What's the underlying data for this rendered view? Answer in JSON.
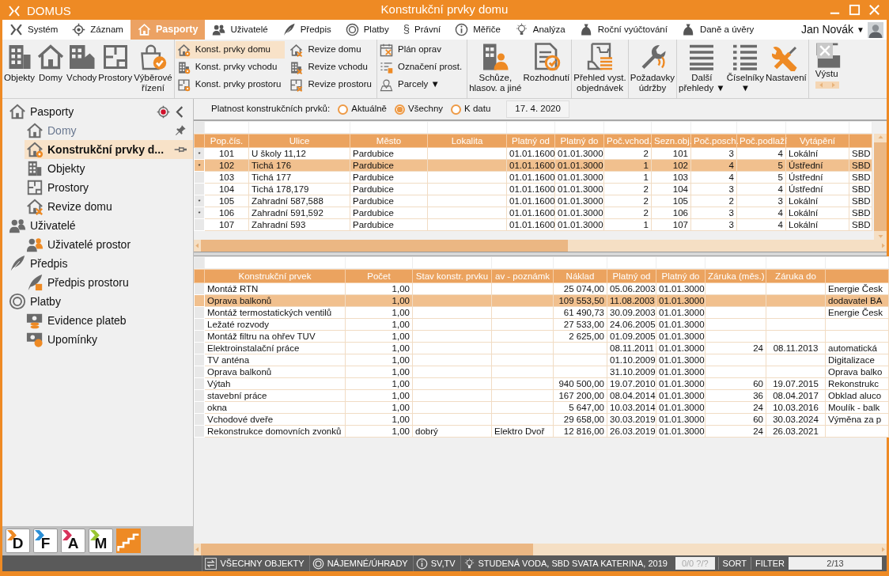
{
  "window": {
    "app": "DOMUS",
    "title": "Konstrukční prvky domu"
  },
  "menu": {
    "tabs": [
      {
        "label": "Systém",
        "selected": false
      },
      {
        "label": "Záznam",
        "selected": false
      },
      {
        "label": "Pasporty",
        "selected": true
      },
      {
        "label": "Uživatelé",
        "selected": false
      },
      {
        "label": "Předpis",
        "selected": false
      },
      {
        "label": "Platby",
        "selected": false
      },
      {
        "label": "Právní",
        "selected": false,
        "symbol": "§"
      },
      {
        "label": "Měřiče",
        "selected": false
      },
      {
        "label": "Analýza",
        "selected": false
      },
      {
        "label": "Roční vyúčtování",
        "selected": false
      },
      {
        "label": "Daně a úvěry",
        "selected": false
      }
    ],
    "user": "Jan Novák",
    "user_caret": "▼"
  },
  "ribbon": {
    "groups": [
      {
        "kind": "large",
        "buttons": [
          {
            "label": "Objekty"
          },
          {
            "label": "Domy"
          },
          {
            "label": "Vchody"
          },
          {
            "label": "Prostory"
          },
          {
            "label": "Výběrové\nřízení"
          }
        ]
      },
      {
        "kind": "small",
        "buttons": [
          {
            "label": "Konst. prvky domu",
            "selected": true
          },
          {
            "label": "Konst. prvky vchodu",
            "selected": false
          },
          {
            "label": "Konst. prvky prostoru",
            "selected": false
          },
          {
            "label": "Revize domu",
            "selected": false
          },
          {
            "label": "Revize vchodu",
            "selected": false
          },
          {
            "label": "Revize prostoru",
            "selected": false
          }
        ]
      },
      {
        "kind": "small",
        "buttons": [
          {
            "label": "Plán oprav",
            "selected": false
          },
          {
            "label": "Označení prost.",
            "selected": false
          },
          {
            "label": "Parcely ▼",
            "selected": false
          }
        ]
      },
      {
        "kind": "large",
        "buttons": [
          {
            "label": "Schůze,\nhlasov. a jiné"
          },
          {
            "label": "Rozhodnutí"
          }
        ]
      },
      {
        "kind": "large",
        "buttons": [
          {
            "label": "Přehled vyst.\nobjednávek"
          }
        ]
      },
      {
        "kind": "large",
        "buttons": [
          {
            "label": "Požadavky\núdržby"
          }
        ]
      },
      {
        "kind": "large",
        "buttons": [
          {
            "label": "Další\npřehledy ▼"
          },
          {
            "label": "Číselníky\n▼"
          },
          {
            "label": "Nastavení"
          }
        ]
      },
      {
        "kind": "cut",
        "buttons": [
          {
            "label": "Výstu"
          }
        ]
      }
    ]
  },
  "sidebar": {
    "items": [
      {
        "label": "Pasporty",
        "children": [
          {
            "label": "Domy",
            "selected": false,
            "dimmed": true,
            "pinned": false
          },
          {
            "label": "Konstrukční prvky d...",
            "selected": true,
            "dimmed": false,
            "pinned": true
          },
          {
            "label": "Objekty",
            "selected": false,
            "dimmed": false
          },
          {
            "label": "Prostory",
            "selected": false,
            "dimmed": false
          },
          {
            "label": "Revize domu",
            "selected": false,
            "dimmed": false
          }
        ]
      },
      {
        "label": "Uživatelé",
        "children": [
          {
            "label": "Uživatelé prostor",
            "selected": false,
            "dimmed": false
          }
        ]
      },
      {
        "label": "Předpis",
        "children": [
          {
            "label": "Předpis prostoru",
            "selected": false,
            "dimmed": false
          }
        ]
      },
      {
        "label": "Platby",
        "children": [
          {
            "label": "Evidence plateb",
            "selected": false,
            "dimmed": false
          },
          {
            "label": "Upomínky",
            "selected": false,
            "dimmed": false
          }
        ]
      }
    ]
  },
  "apps": [
    {
      "kind": "letter",
      "letter": "D",
      "color": "#ee8a24"
    },
    {
      "kind": "letter",
      "letter": "F",
      "color": "#2b8fd6"
    },
    {
      "kind": "letter",
      "letter": "A",
      "color": "#d8325a"
    },
    {
      "kind": "letter",
      "letter": "M",
      "color": "#9ac531"
    },
    {
      "kind": "stairs",
      "color": "#ee8a24"
    }
  ],
  "filter": {
    "label": "Platnost konstrukčních prvků:",
    "options": [
      {
        "label": "Aktuálně",
        "selected": false
      },
      {
        "label": "Všechny",
        "selected": true
      },
      {
        "label": "K datu",
        "selected": false
      }
    ],
    "date": "17. 4. 2020"
  },
  "upper_table": {
    "columns": [
      "Pop.čís.",
      "Ulice",
      "Město",
      "Lokalita",
      "Platný od",
      "Platný do",
      "Poč.vchod.",
      "Sezn.obj.",
      "Poč.posch.",
      "Poč.podlaží",
      "Vytápění"
    ],
    "rows": [
      {
        "flag": "*",
        "selected": false,
        "cells": [
          "101",
          "U školy 11,12",
          "Pardubice",
          null,
          "01.01.1600",
          "01.01.3000",
          "2",
          "101",
          "3",
          "4",
          "Lokální",
          "SBD"
        ]
      },
      {
        "flag": "*",
        "selected": true,
        "cells": [
          "102",
          "Tichá 176",
          "Pardubice",
          null,
          "01.01.1600",
          "01.01.3000",
          "1",
          "102",
          "4",
          "5",
          "Ústřední",
          "SBD"
        ]
      },
      {
        "selected": false,
        "cells": [
          "103",
          "Tichá 177",
          "Pardubice",
          null,
          "01.01.1600",
          "01.01.3000",
          "1",
          "103",
          "4",
          "5",
          "Ústřední",
          "SBD"
        ]
      },
      {
        "selected": false,
        "cells": [
          "104",
          "Tichá 178,179",
          "Pardubice",
          null,
          "01.01.1600",
          "01.01.3000",
          "2",
          "104",
          "3",
          "4",
          "Ústřední",
          "SBD"
        ]
      },
      {
        "flag": "*",
        "selected": false,
        "cells": [
          "105",
          "Zahradní 587,588",
          "Pardubice",
          null,
          "01.01.1600",
          "01.01.3000",
          "2",
          "105",
          "2",
          "3",
          "Lokální",
          "SBD"
        ]
      },
      {
        "flag": "*",
        "selected": false,
        "cells": [
          "106",
          "Zahradní 591,592",
          "Pardubice",
          null,
          "01.01.1600",
          "01.01.3000",
          "2",
          "106",
          "3",
          "4",
          "Lokální",
          "SBD"
        ]
      },
      {
        "selected": false,
        "cells": [
          "107",
          "Zahradní 593",
          "Pardubice",
          null,
          "01.01.1600",
          "01.01.3000",
          "1",
          "107",
          "3",
          "4",
          "Lokální",
          "SBD"
        ]
      }
    ]
  },
  "lower_table": {
    "columns": [
      "Konstrukční prvek",
      "Počet",
      "Stav konstr. prvku",
      "av - poznámk",
      "Náklad",
      "Platný od",
      "Platný do",
      "Záruka (měs.)",
      "Záruka do"
    ],
    "rows": [
      {
        "selected": false,
        "cells": [
          "Montáž RTN",
          "1,00",
          null,
          null,
          "25 074,00",
          "05.06.2003",
          "01.01.3000",
          null,
          null,
          "Energie Česk"
        ]
      },
      {
        "selected": true,
        "cells": [
          "Oprava balkonů",
          "1,00",
          null,
          null,
          "109 553,50",
          "11.08.2003",
          "01.01.3000",
          null,
          null,
          "dodavatel BA"
        ]
      },
      {
        "selected": false,
        "cells": [
          "Montáž termostatických ventilů",
          "1,00",
          null,
          null,
          "61 490,73",
          "30.09.2003",
          "01.01.3000",
          null,
          null,
          "Energie Česk"
        ]
      },
      {
        "selected": false,
        "cells": [
          "Ležaté rozvody",
          "1,00",
          null,
          null,
          "27 533,00",
          "24.06.2005",
          "01.01.3000",
          null,
          null,
          null
        ]
      },
      {
        "selected": false,
        "cells": [
          "Montáž filtru na ohřev TUV",
          "1,00",
          null,
          null,
          "2 625,00",
          "01.09.2005",
          "01.01.3000",
          null,
          null,
          null
        ]
      },
      {
        "selected": false,
        "cells": [
          "Elektroinstalační práce",
          "1,00",
          null,
          null,
          null,
          "08.11.2011",
          "01.01.3000",
          "24",
          "08.11.2013",
          "automatická"
        ]
      },
      {
        "selected": false,
        "cells": [
          "TV anténa",
          "1,00",
          null,
          null,
          null,
          "01.10.2009",
          "01.01.3000",
          null,
          null,
          "Digitalizace"
        ]
      },
      {
        "selected": false,
        "cells": [
          "Oprava balkonů",
          "1,00",
          null,
          null,
          null,
          "31.10.2009",
          "01.01.3000",
          null,
          null,
          "Oprava balko"
        ]
      },
      {
        "selected": false,
        "cells": [
          "Výtah",
          "1,00",
          null,
          null,
          "940 500,00",
          "19.07.2010",
          "01.01.3000",
          "60",
          "19.07.2015",
          "Rekonstrukc"
        ]
      },
      {
        "selected": false,
        "cells": [
          "stavební práce",
          "1,00",
          null,
          null,
          "167 200,00",
          "08.04.2014",
          "01.01.3000",
          "36",
          "08.04.2017",
          "Obklad aluco"
        ]
      },
      {
        "selected": false,
        "cells": [
          "okna",
          "1,00",
          null,
          null,
          "5 647,00",
          "10.03.2014",
          "01.01.3000",
          "24",
          "10.03.2016",
          "Moulík - balk"
        ]
      },
      {
        "selected": false,
        "cells": [
          "Vchodové dveře",
          "1,00",
          null,
          null,
          "29 658,00",
          "30.03.2019",
          "01.01.3000",
          "60",
          "30.03.2024",
          "Výměna za p"
        ]
      },
      {
        "selected": false,
        "cells": [
          "Rekonstrukce domovních zvonků",
          "1,00",
          "dobrý",
          "Elektro Dvoř",
          "12 816,00",
          "26.03.2019",
          "01.01.3000",
          "24",
          "26.03.2021",
          null
        ]
      }
    ]
  },
  "status_bar": {
    "items": [
      "VŠECHNY OBJEKTY",
      "NÁJEMNÉ/ÚHRADY",
      "SV,TV",
      "STUDENÁ VODA, SBD SVATA KATERINA, 2019"
    ],
    "position": "0/0 ?/?",
    "sort": "SORT",
    "filter": "FILTER",
    "page": "2/13"
  }
}
